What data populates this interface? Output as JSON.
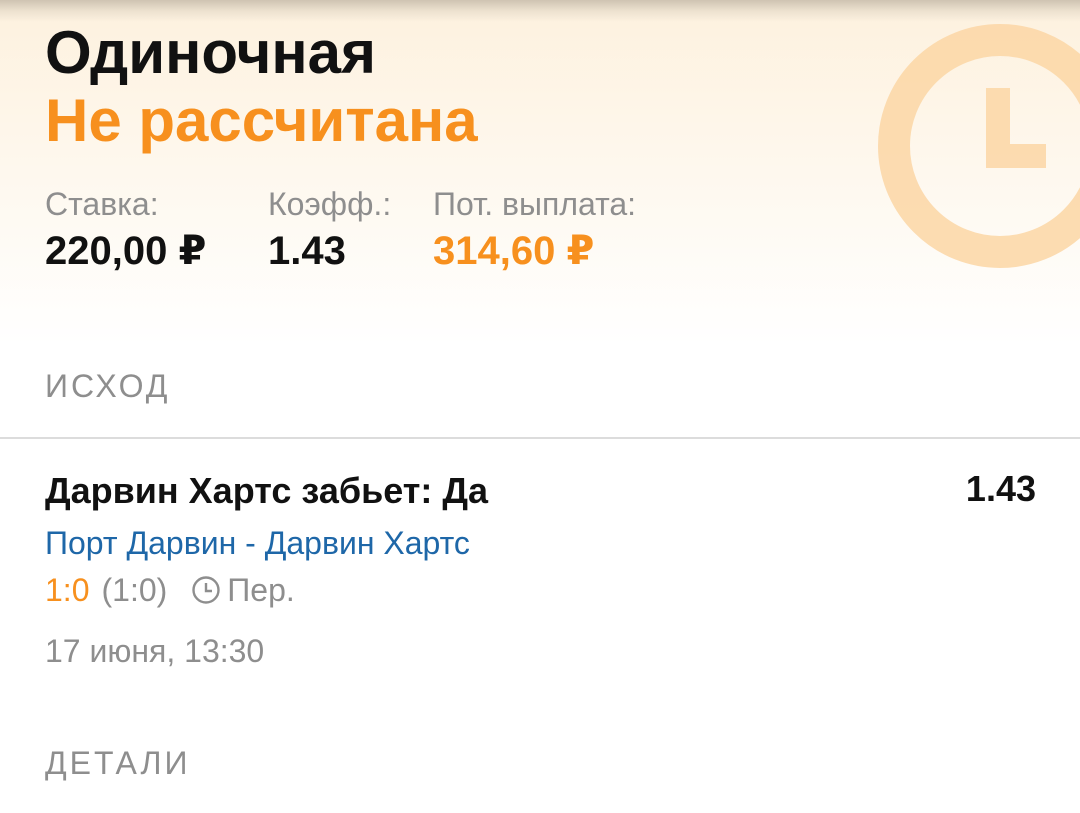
{
  "bet": {
    "type": "Одиночная",
    "status": "Не рассчитана",
    "stake_label": "Ставка:",
    "stake_value": "220,00 ₽",
    "odds_label": "Коэфф.:",
    "odds_value": "1.43",
    "payout_label": "Пот. выплата:",
    "payout_value": "314,60 ₽"
  },
  "sections": {
    "outcome_title": "ИСХОД",
    "details_title": "ДЕТАЛИ"
  },
  "outcome": {
    "selection": "Дарвин Хартс забьет: Да",
    "odds": "1.43",
    "match": "Порт Дарвин - Дарвин Хартс",
    "score": "1:0",
    "halftime_score": "(1:0)",
    "period": "Пер.",
    "datetime": "17 июня, 13:30"
  },
  "icons": {
    "status_icon": "clock-icon",
    "period_icon": "clock-icon"
  },
  "colors": {
    "accent": "#f7901e",
    "link": "#1e67a8",
    "muted": "#8e8e8e",
    "text": "#111111"
  }
}
